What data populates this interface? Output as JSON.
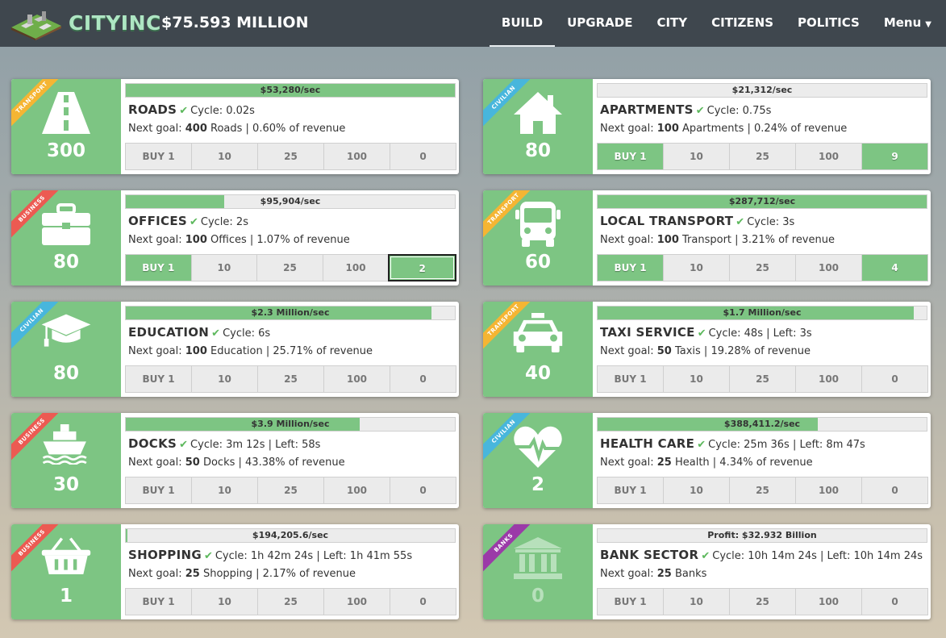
{
  "nav": {
    "brand": "CITYINC",
    "money": "$75.593 MILLION",
    "tabs": [
      "BUILD",
      "UPGRADE",
      "CITY",
      "CITIZENS",
      "POLITICS",
      "Menu"
    ],
    "active_tab": "BUILD"
  },
  "colors": {
    "green": "#7dc583",
    "navbar": "#3f474e",
    "transport": "#f5b533",
    "civilian": "#48b6dc",
    "business": "#ec5a52",
    "banks": "#9b3aa8"
  },
  "cards": [
    {
      "category": "TRANSPORT",
      "icon": "road-icon",
      "count": "300",
      "income": "$53,280/sec",
      "progress": 1.0,
      "name": "ROADS",
      "cycle": "Cycle: 0.02s",
      "goal_prefix": "Next goal:",
      "goal_num": "400",
      "goal_rest": "Roads | 0.60% of revenue",
      "buttons": [
        "BUY 1",
        "10",
        "25",
        "100",
        "0"
      ],
      "active": []
    },
    {
      "category": "CIVILIAN",
      "icon": "house-icon",
      "count": "80",
      "income": "$21,312/sec",
      "progress": 0.0,
      "name": "APARTMENTS",
      "cycle": "Cycle: 0.75s",
      "goal_prefix": "Next goal:",
      "goal_num": "100",
      "goal_rest": "Apartments | 0.24% of revenue",
      "buttons": [
        "BUY 1",
        "10",
        "25",
        "100",
        "9"
      ],
      "active": [
        0,
        4
      ]
    },
    {
      "category": "BUSINESS",
      "icon": "briefcase-icon",
      "count": "80",
      "income": "$95,904/sec",
      "progress": 0.3,
      "name": "OFFICES",
      "cycle": "Cycle: 2s",
      "goal_prefix": "Next goal:",
      "goal_num": "100",
      "goal_rest": "Offices | 1.07% of revenue",
      "buttons": [
        "BUY 1",
        "10",
        "25",
        "100",
        "2"
      ],
      "active": [
        0,
        4
      ],
      "selected": 4
    },
    {
      "category": "TRANSPORT",
      "icon": "bus-icon",
      "count": "60",
      "income": "$287,712/sec",
      "progress": 1.0,
      "name": "LOCAL TRANSPORT",
      "cycle": "Cycle: 3s",
      "goal_prefix": "Next goal:",
      "goal_num": "100",
      "goal_rest": "Transport | 3.21% of revenue",
      "buttons": [
        "BUY 1",
        "10",
        "25",
        "100",
        "4"
      ],
      "active": [
        0,
        4
      ]
    },
    {
      "category": "CIVILIAN",
      "icon": "graduation-cap-icon",
      "count": "80",
      "income": "$2.3 Million/sec",
      "progress": 0.93,
      "name": "EDUCATION",
      "cycle": "Cycle: 6s",
      "goal_prefix": "Next goal:",
      "goal_num": "100",
      "goal_rest": "Education | 25.71% of revenue",
      "buttons": [
        "BUY 1",
        "10",
        "25",
        "100",
        "0"
      ],
      "active": []
    },
    {
      "category": "TRANSPORT",
      "icon": "taxi-icon",
      "count": "40",
      "income": "$1.7 Million/sec",
      "progress": 0.96,
      "name": "TAXI SERVICE",
      "cycle": "Cycle: 48s | Left: 3s",
      "goal_prefix": "Next goal:",
      "goal_num": "50",
      "goal_rest": "Taxis | 19.28% of revenue",
      "buttons": [
        "BUY 1",
        "10",
        "25",
        "100",
        "0"
      ],
      "active": []
    },
    {
      "category": "BUSINESS",
      "icon": "ship-icon",
      "count": "30",
      "income": "$3.9 Million/sec",
      "progress": 0.71,
      "name": "DOCKS",
      "cycle": "Cycle: 3m 12s | Left: 58s",
      "goal_prefix": "Next goal:",
      "goal_num": "50",
      "goal_rest": "Docks | 43.38% of revenue",
      "buttons": [
        "BUY 1",
        "10",
        "25",
        "100",
        "0"
      ],
      "active": []
    },
    {
      "category": "CIVILIAN",
      "icon": "heartbeat-icon",
      "count": "2",
      "income": "$388,411.2/sec",
      "progress": 0.67,
      "name": "HEALTH CARE",
      "cycle": "Cycle: 25m 36s | Left: 8m 47s",
      "goal_prefix": "Next goal:",
      "goal_num": "25",
      "goal_rest": "Health | 4.34% of revenue",
      "buttons": [
        "BUY 1",
        "10",
        "25",
        "100",
        "0"
      ],
      "active": []
    },
    {
      "category": "BUSINESS",
      "icon": "basket-icon",
      "count": "1",
      "income": "$194,205.6/sec",
      "progress": 0.005,
      "name": "SHOPPING",
      "cycle": "Cycle: 1h 42m 24s | Left: 1h 41m 55s",
      "goal_prefix": "Next goal:",
      "goal_num": "25",
      "goal_rest": "Shopping | 2.17% of revenue",
      "buttons": [
        "BUY 1",
        "10",
        "25",
        "100",
        "0"
      ],
      "active": []
    },
    {
      "category": "BANKS",
      "icon": "bank-icon",
      "count": "0",
      "income": "Profit: $32.932 Billion",
      "progress": 0.0,
      "name": "BANK SECTOR",
      "cycle": "Cycle: 10h 14m 24s | Left: 10h 14m 24s",
      "goal_prefix": "Next goal:",
      "goal_num": "25",
      "goal_rest": "Banks",
      "buttons": [
        "BUY 1",
        "10",
        "25",
        "100",
        "0"
      ],
      "active": [],
      "faded": true
    }
  ]
}
